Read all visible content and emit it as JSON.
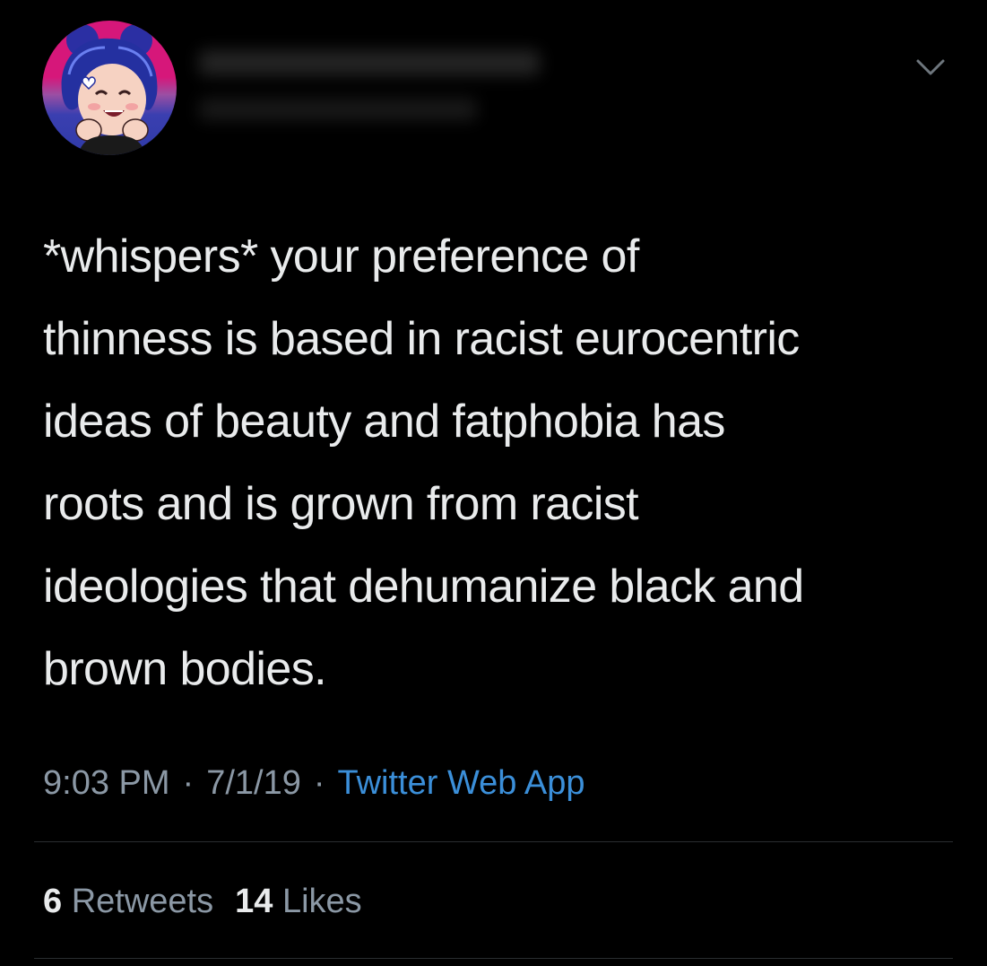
{
  "tweet": {
    "text": "*whispers* your preference of\nthinness is based in racist eurocentric\nideas of beauty and fatphobia has\nroots and is grown from racist\nideologies that dehumanize black and\nbrown bodies.",
    "time": "9:03 PM",
    "date": "7/1/19",
    "separator": "·",
    "source": "Twitter Web App"
  },
  "stats": {
    "retweets_count": "6",
    "retweets_label": "Retweets",
    "likes_count": "14",
    "likes_label": "Likes"
  },
  "icons": {
    "menu": "chevron-down-icon"
  },
  "colors": {
    "background": "#000000",
    "text": "#e9ebec",
    "muted": "#8b98a5",
    "link": "#3b8fd9",
    "divider": "#2a2d30"
  }
}
